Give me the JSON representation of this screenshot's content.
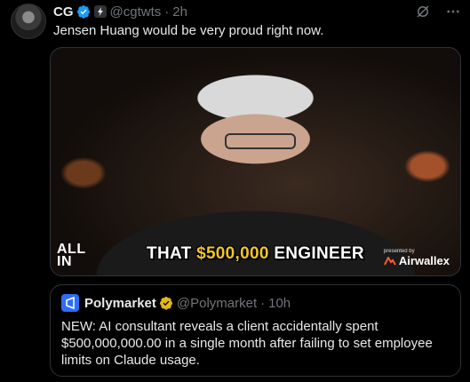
{
  "tweet": {
    "author_name": "CG",
    "handle": "@cgtwts",
    "separator": "·",
    "time": "2h",
    "text": "Jensen Huang would be very proud right now."
  },
  "media": {
    "caption_prefix": "THAT ",
    "caption_money": "$500,000",
    "caption_suffix": " ENGINEER",
    "watermark_line1": "ALL",
    "watermark_line2": "IN",
    "presented_by": "presented by",
    "sponsor": "Airwallex"
  },
  "quote": {
    "author_name": "Polymarket",
    "handle": "@Polymarket",
    "separator": "·",
    "time": "10h",
    "text": "NEW: AI consultant reveals a client accidentally spent $500,000,000.00 in a single month after failing to set employee limits on Claude usage."
  },
  "colors": {
    "background": "#000000",
    "text": "#e7e9ea",
    "muted": "#71767b",
    "verified_blue": "#1d9bf0",
    "verified_gold": "#e2b719",
    "caption_money": "#f3c623",
    "polymarket_blue": "#2d6ef5"
  },
  "icons": [
    "verified-badge-icon",
    "automated-badge-icon",
    "grok-icon",
    "more-icon",
    "polymarket-logo-icon",
    "airwallex-logo-icon"
  ]
}
